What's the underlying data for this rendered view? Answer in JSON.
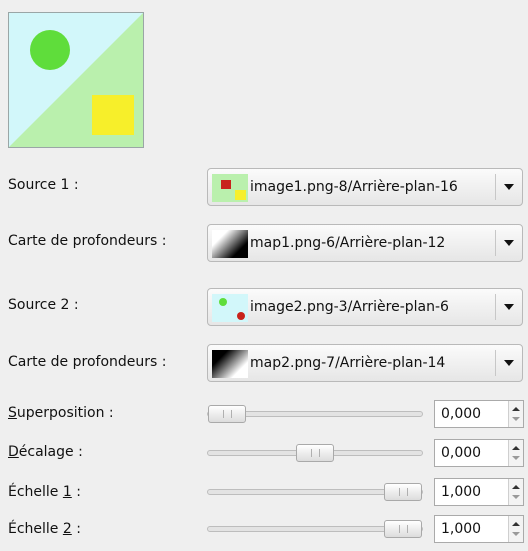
{
  "preview": {
    "name": "composition preview"
  },
  "source1": {
    "label": "Source 1 :",
    "value": "image1.png-8/Arrière-plan-16"
  },
  "depth1": {
    "label": "Carte de profondeurs :",
    "value": "map1.png-6/Arrière-plan-12"
  },
  "source2": {
    "label": "Source 2 :",
    "value": "image2.png-3/Arrière-plan-6"
  },
  "depth2": {
    "label": "Carte de profondeurs :",
    "value": "map2.png-7/Arrière-plan-14"
  },
  "overlap": {
    "label_first": "S",
    "label_rest": "uperposition :",
    "value": "0,000",
    "slider_fraction": 0.0
  },
  "offset": {
    "label_first": "D",
    "label_rest": "écalage :",
    "value": "0,000",
    "slider_fraction": 0.5
  },
  "scale1": {
    "label_pre": "Échelle ",
    "label_u": "1",
    "label_post": " :",
    "value": "1,000",
    "slider_fraction": 1.0
  },
  "scale2": {
    "label_pre": "Échelle ",
    "label_u": "2",
    "label_post": " :",
    "value": "1,000",
    "slider_fraction": 1.0
  },
  "colors": {
    "green": "#5fdd3b",
    "yellow": "#f7ef2a",
    "lightgreen": "#baf0ad",
    "cyan": "#d2f7fa",
    "red": "#c8241c"
  }
}
